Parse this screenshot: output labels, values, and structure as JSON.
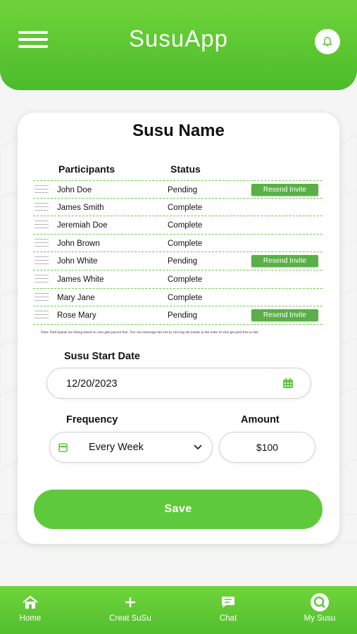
{
  "app": {
    "title": "SusuApp"
  },
  "card": {
    "title": "Susu Name",
    "columns": {
      "participants": "Participants",
      "status": "Status"
    },
    "participants": [
      {
        "name": "John Doe",
        "status": "Pending",
        "action": "Resend Invite"
      },
      {
        "name": "James Smith",
        "status": "Complete",
        "action": ""
      },
      {
        "name": "Jeremiah Doe",
        "status": "Complete",
        "action": ""
      },
      {
        "name": "John Brown",
        "status": "Complete",
        "action": ""
      },
      {
        "name": "John White",
        "status": "Pending",
        "action": "Resend Invite"
      },
      {
        "name": "James White",
        "status": "Complete",
        "action": ""
      },
      {
        "name": "Mary Jane",
        "status": "Complete",
        "action": ""
      },
      {
        "name": "Rose Mary",
        "status": "Pending",
        "action": "Resend Invite"
      }
    ],
    "note": "Note: Participants are listing based on who gets payout first. You can rearrange this list by moving the names in the order of who get paid first to last.",
    "start_date": {
      "label": "Susu Start Date",
      "value": "12/20/2023"
    },
    "frequency": {
      "label": "Frequency",
      "value": "Every Week"
    },
    "amount": {
      "label": "Amount",
      "value": "$100"
    },
    "save_label": "Save"
  },
  "nav": {
    "home": "Home",
    "create": "Creat SuSu",
    "chat": "Chat",
    "my_susu": "My Susu"
  },
  "colors": {
    "primary": "#5fc93c",
    "button": "#59b046"
  }
}
